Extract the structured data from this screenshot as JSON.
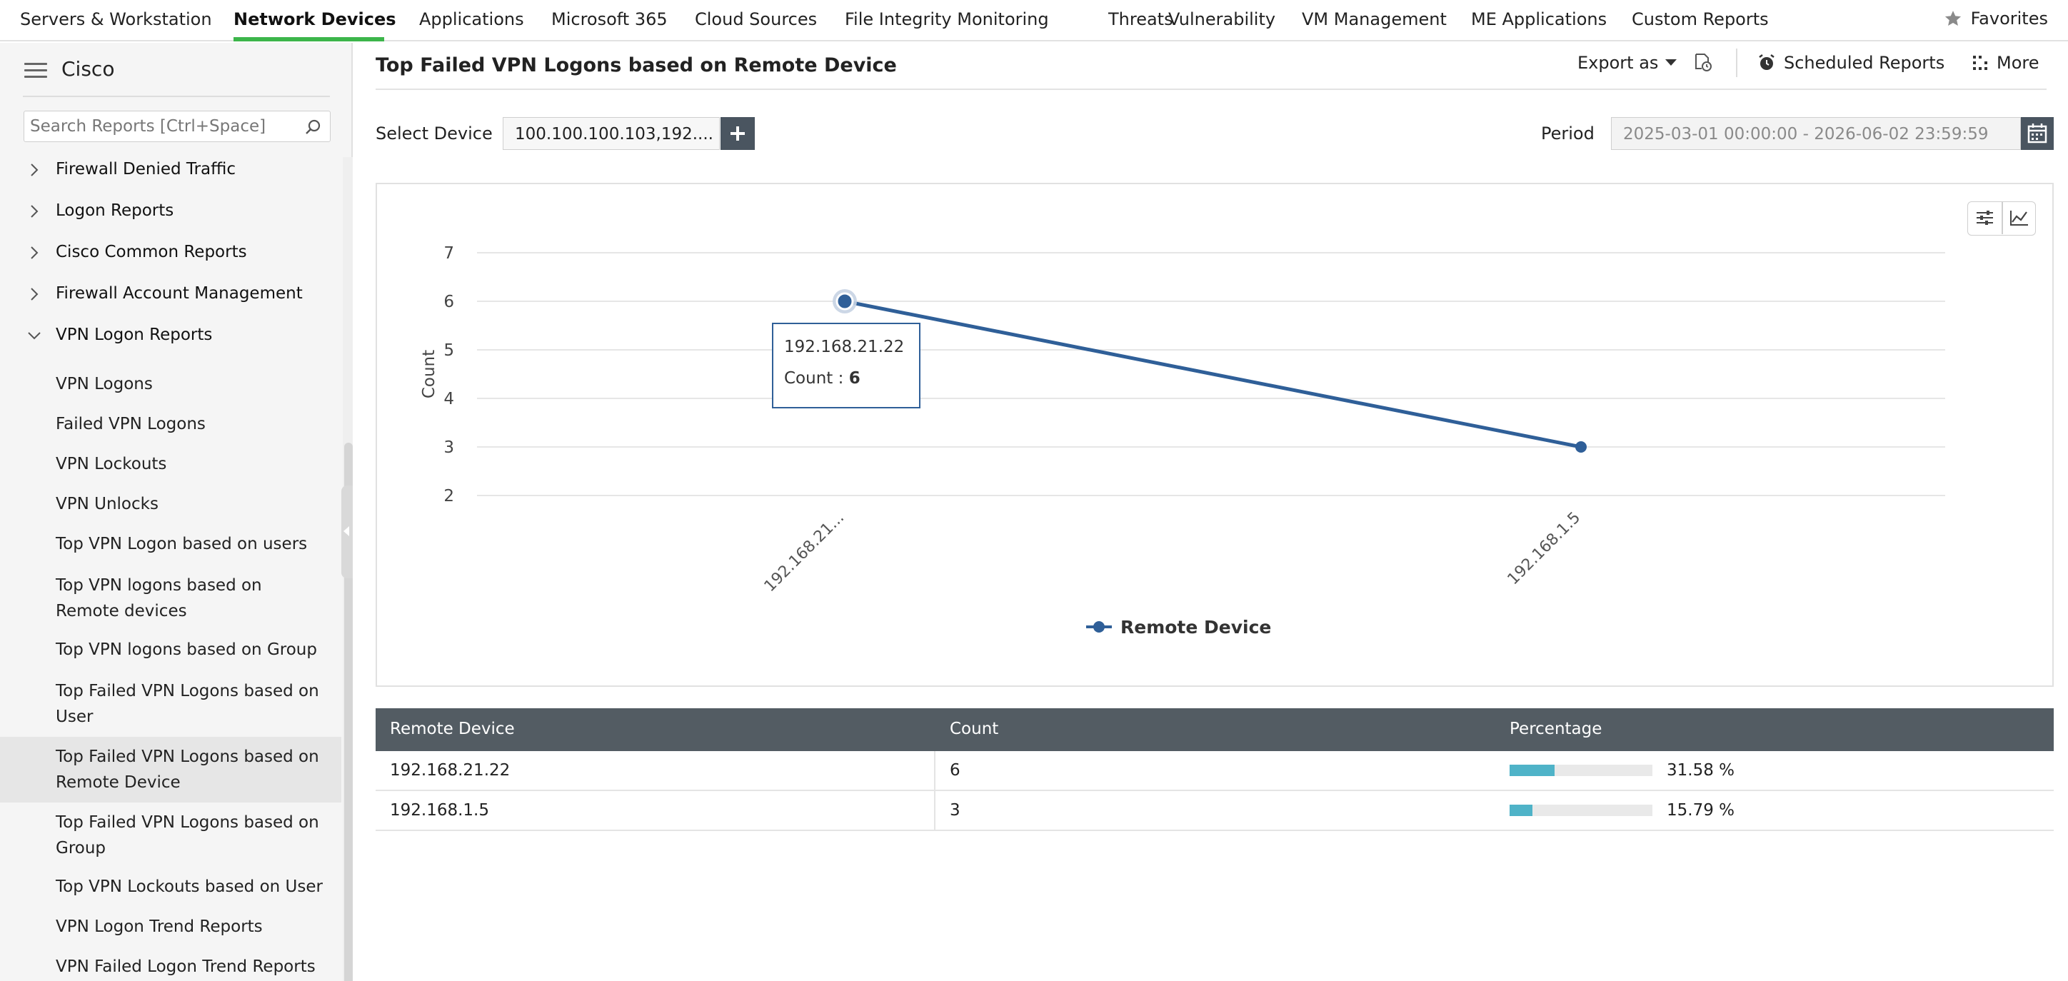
{
  "topnav": {
    "tabs": [
      {
        "label": "Servers & Workstation",
        "active": false
      },
      {
        "label": "Network Devices",
        "active": true
      },
      {
        "label": "Applications",
        "active": false
      },
      {
        "label": "Microsoft 365",
        "active": false
      },
      {
        "label": "Cloud Sources",
        "active": false
      },
      {
        "label": "File Integrity Monitoring",
        "active": false
      },
      {
        "label": "Threats",
        "active": false
      },
      {
        "label": "Vulnerability",
        "active": false
      },
      {
        "label": "VM Management",
        "active": false
      },
      {
        "label": "ME Applications",
        "active": false
      },
      {
        "label": "Custom Reports",
        "active": false
      }
    ],
    "favorites_label": "Favorites",
    "accent_color": "#3cb54a"
  },
  "sidebar": {
    "title": "Cisco",
    "search_placeholder": "Search Reports [Ctrl+Space]",
    "groups": [
      {
        "label": "Firewall Denied Traffic",
        "expanded": false
      },
      {
        "label": "Logon Reports",
        "expanded": false
      },
      {
        "label": "Cisco Common Reports",
        "expanded": false
      },
      {
        "label": "Firewall Account Management",
        "expanded": false
      },
      {
        "label": "VPN Logon Reports",
        "expanded": true
      }
    ],
    "items": [
      {
        "label": "VPN Logons"
      },
      {
        "label": "Failed VPN Logons"
      },
      {
        "label": "VPN Lockouts"
      },
      {
        "label": "VPN Unlocks"
      },
      {
        "label": "Top VPN Logon based on users"
      },
      {
        "label": "Top VPN logons based on Remote devices"
      },
      {
        "label": "Top VPN logons based on Group"
      },
      {
        "label": "Top Failed VPN Logons based on User"
      },
      {
        "label": "Top Failed VPN Logons based on Remote Device",
        "selected": true
      },
      {
        "label": "Top Failed VPN Logons based on Group"
      },
      {
        "label": "Top VPN Lockouts based on User"
      },
      {
        "label": "VPN Logon Trend Reports"
      },
      {
        "label": "VPN Failed Logon Trend Reports"
      }
    ]
  },
  "report": {
    "title": "Top Failed VPN Logons based on Remote Device",
    "export_label": "Export as",
    "scheduled_label": "Scheduled Reports",
    "more_label": "More",
    "select_device_label": "Select Device",
    "device_value": "100.100.100.103,192....",
    "period_label": "Period",
    "period_value": "2025-03-01 00:00:00 - 2026-06-02 23:59:59"
  },
  "chart_data": {
    "type": "line",
    "categories": [
      "192.168.21.22",
      "192.168.1.5"
    ],
    "tick_labels": [
      "192.168.21...",
      "192.168.1.5"
    ],
    "series": [
      {
        "name": "Remote Device",
        "values": [
          6,
          3
        ],
        "color": "#2f5f98"
      }
    ],
    "ylabel": "Count",
    "xlabel": "",
    "ylim": [
      2,
      7
    ],
    "yticks": [
      2,
      3,
      4,
      5,
      6,
      7
    ],
    "grid": true,
    "legend": "bottom-center",
    "tooltip": {
      "title": "192.168.21.22",
      "label": "Count : ",
      "value": "6"
    }
  },
  "table": {
    "headers": [
      "Remote Device",
      "Count",
      "Percentage"
    ],
    "rows": [
      {
        "device": "192.168.21.22",
        "count": "6",
        "percentage": "31.58 %",
        "fraction": 0.3158
      },
      {
        "device": "192.168.1.5",
        "count": "3",
        "percentage": "15.79 %",
        "fraction": 0.1579
      }
    ],
    "bar_color": "#4fb3c8"
  }
}
